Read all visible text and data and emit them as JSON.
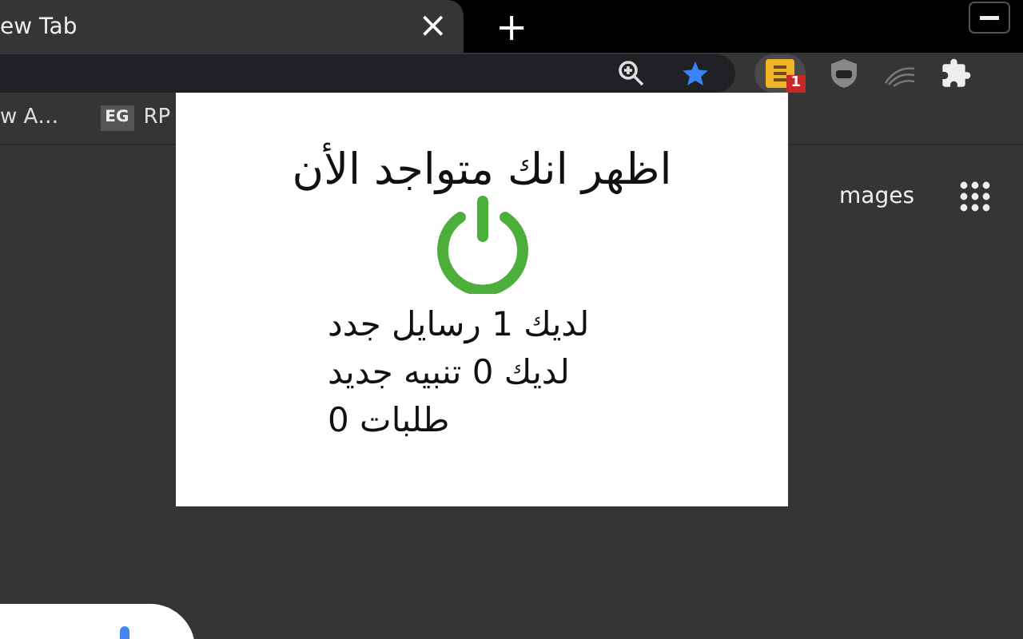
{
  "tab": {
    "title": "ew Tab",
    "close": "×"
  },
  "new_tab": "+",
  "extension_badge": "1",
  "bookmarks_bar": {
    "cut_bookmark": "w A…",
    "bookmark": {
      "favicon": "EG",
      "label": "RP"
    }
  },
  "page": {
    "images_link": "mages"
  },
  "popup": {
    "title": "اظهر انك متواجد الأن",
    "online": true,
    "lines": [
      "لديك 1 رسايل جدد",
      "لديك 0 تنبيه جديد",
      "طلبات 0"
    ]
  }
}
